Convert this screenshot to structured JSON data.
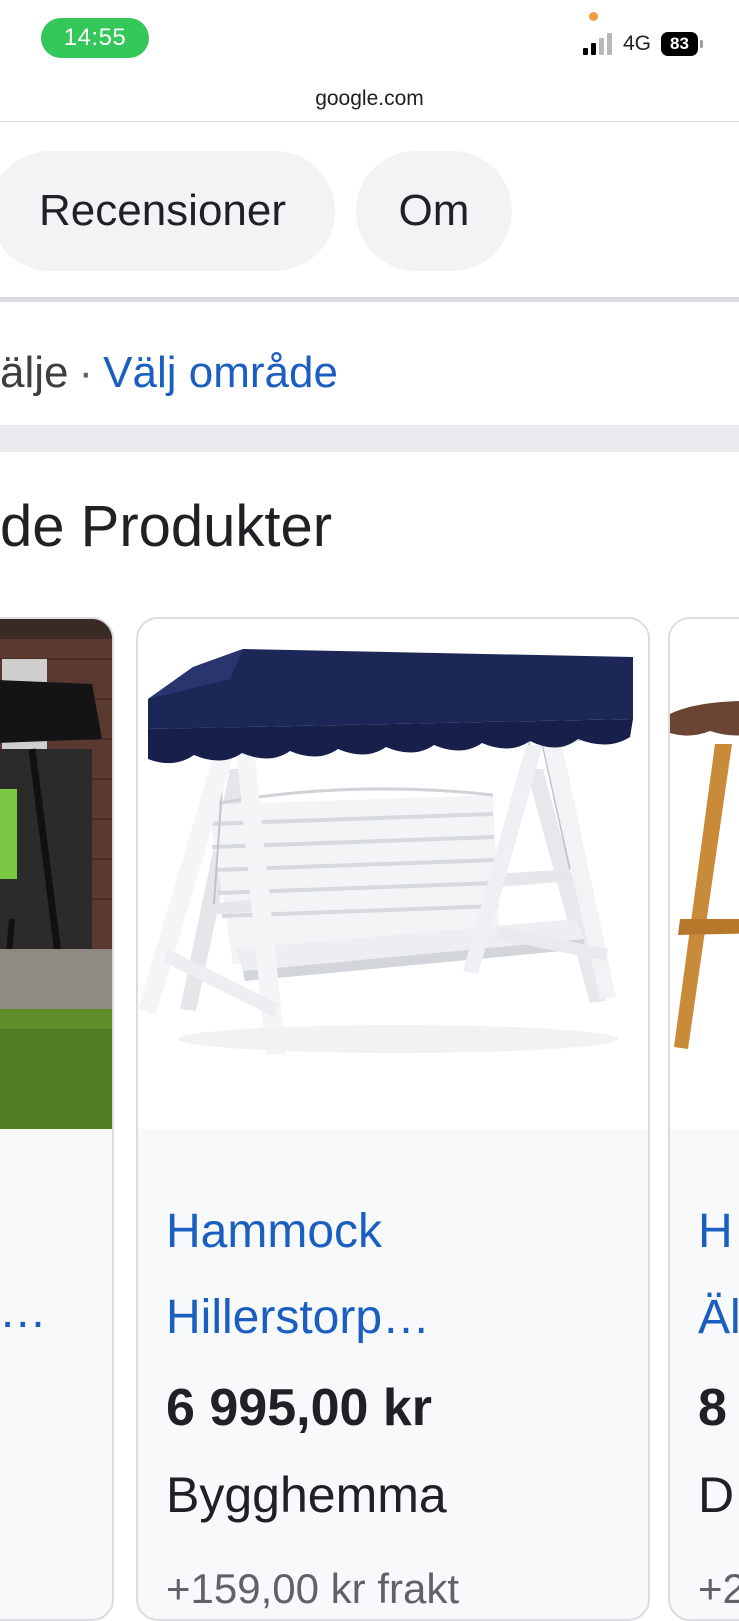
{
  "status_bar": {
    "time": "14:55",
    "network": "4G",
    "battery": "83"
  },
  "browser": {
    "url": "google.com"
  },
  "tabs": {
    "reviews": "Recensioner",
    "about": "Om"
  },
  "location": {
    "prefix": "älje",
    "separator": "·",
    "link": "Välj område"
  },
  "section": {
    "title": "de Produkter"
  },
  "products": {
    "left": {
      "title_line2": "a…"
    },
    "main": {
      "title_line1": "Hammock",
      "title_line2": "Hillerstorp…",
      "price": "6 995,00 kr",
      "store": "Bygghemma",
      "shipping": "+159,00 kr frakt"
    },
    "right": {
      "title_line1": "H",
      "title_line2": "Äl",
      "price": "8",
      "store": "D",
      "shipping": "+2"
    }
  },
  "colors": {
    "link": "#1a5fc0",
    "time_pill": "#34c759",
    "chip_bg": "#f1f3f4",
    "canopy_navy": "#1d2757"
  }
}
